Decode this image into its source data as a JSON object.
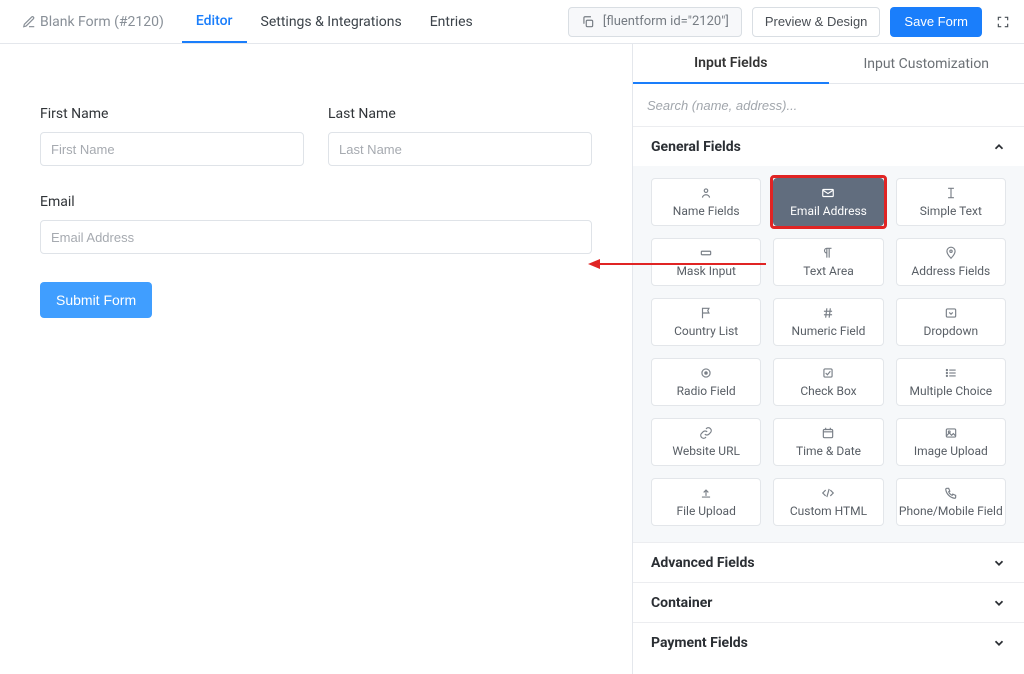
{
  "header": {
    "form_name": "Blank Form (#2120)",
    "tabs": {
      "editor": "Editor",
      "settings": "Settings & Integrations",
      "entries": "Entries"
    },
    "shortcode": "[fluentform id=\"2120\"]",
    "preview_btn": "Preview & Design",
    "save_btn": "Save Form"
  },
  "canvas": {
    "first_name": {
      "label": "First Name",
      "placeholder": "First Name"
    },
    "last_name": {
      "label": "Last Name",
      "placeholder": "Last Name"
    },
    "email": {
      "label": "Email",
      "placeholder": "Email Address"
    },
    "submit_btn": "Submit Form"
  },
  "sidebar": {
    "tabs": {
      "input_fields": "Input Fields",
      "customization": "Input Customization"
    },
    "search_placeholder": "Search (name, address)...",
    "sections": {
      "general": "General Fields",
      "advanced": "Advanced Fields",
      "container": "Container",
      "payment": "Payment Fields"
    },
    "tiles": {
      "name": "Name Fields",
      "email": "Email Address",
      "text": "Simple Text",
      "mask": "Mask Input",
      "textarea": "Text Area",
      "address": "Address Fields",
      "country": "Country List",
      "numeric": "Numeric Field",
      "dropdown": "Dropdown",
      "radio": "Radio Field",
      "checkbox": "Check Box",
      "multichoice": "Multiple Choice",
      "url": "Website URL",
      "date": "Time & Date",
      "image": "Image Upload",
      "file": "File Upload",
      "html": "Custom HTML",
      "phone": "Phone/Mobile Field"
    }
  }
}
